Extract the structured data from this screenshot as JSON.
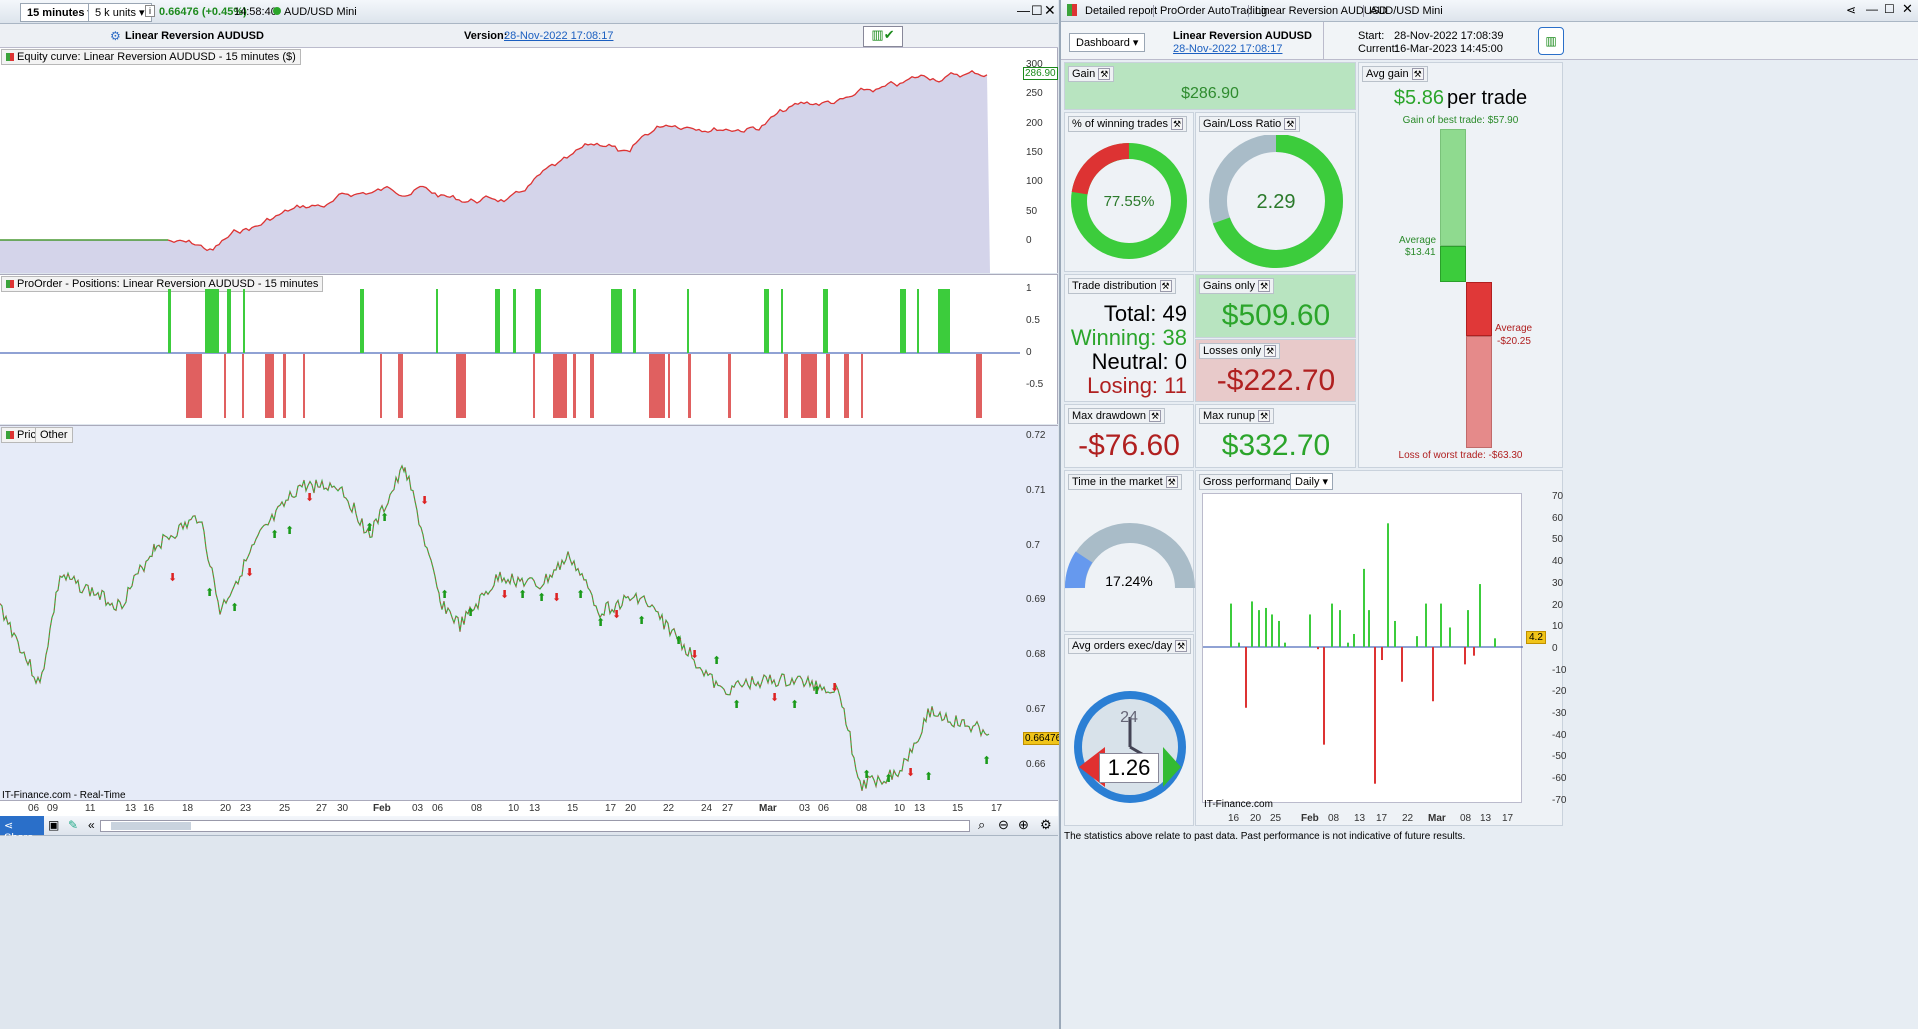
{
  "topbar": {
    "timeframe": "15 minutes",
    "units": "5 k units",
    "price": "0.66476 (+0.45%)",
    "time": "14:58:40",
    "instrument": "AUD/USD Mini"
  },
  "strategy": {
    "name": "Linear Reversion AUDUSD",
    "version_label": "Version:",
    "version": "28-Nov-2022 17:08:17"
  },
  "panels": {
    "equity": "Equity curve: Linear Reversion AUDUSD - 15 minutes ($)",
    "positions": "ProOrder - Positions: Linear Reversion AUDUSD - 15 minutes",
    "price": "Price",
    "other": "Other"
  },
  "equity_axis": [
    "300",
    "250",
    "200",
    "150",
    "100",
    "50",
    "0"
  ],
  "equity_last": "286.90",
  "pos_axis": [
    "1",
    "0.5",
    "0",
    "-0.5"
  ],
  "price_axis": [
    "0.72",
    "0.71",
    "0.7",
    "0.69",
    "0.68",
    "0.67",
    "0.66"
  ],
  "price_last": "0.66476",
  "x_axis": [
    "06",
    "09",
    "11",
    "13",
    "16",
    "18",
    "20",
    "23",
    "25",
    "27",
    "30",
    "Feb",
    "03",
    "06",
    "08",
    "10",
    "13",
    "15",
    "17",
    "20",
    "22",
    "24",
    "27",
    "Mar",
    "03",
    "06",
    "08",
    "10",
    "13",
    "15",
    "17"
  ],
  "footer_src": "IT-Finance.com - Real-Time",
  "bottom": {
    "share": "Share"
  },
  "tabs": [
    "Detailed report",
    "ProOrder AutoTrading",
    "Linear Reversion AUDUSD",
    "AUD/USD Mini"
  ],
  "report": {
    "dashboard": "Dashboard",
    "name": "Linear Reversion AUDUSD",
    "date": "28-Nov-2022 17:08:17",
    "start_label": "Start:",
    "start": "28-Nov-2022 17:08:39",
    "current_label": "Current:",
    "current": "16-Mar-2023 14:45:00"
  },
  "stats": {
    "gain_t": "Gain",
    "gain": "$286.90",
    "avg_t": "Avg gain",
    "avg": "$5.86",
    "avg_unit": "per trade",
    "best": "Gain of best trade: $57.90",
    "avg_lbl": "Average",
    "avg_pos": "$13.41",
    "avg_neg_lbl": "Average",
    "avg_neg": "-$20.25",
    "worst": "Loss of worst trade: -$63.30",
    "win_t": "% of winning trades",
    "win": "77.55%",
    "gl_t": "Gain/Loss Ratio",
    "gl": "2.29",
    "td_t": "Trade distribution",
    "total": "Total: 49",
    "winning": "Winning: 38",
    "neutral": "Neutral: 0",
    "losing": "Losing: 11",
    "go_t": "Gains only",
    "go": "$509.60",
    "lo_t": "Losses only",
    "lo": "-$222.70",
    "md_t": "Max drawdown",
    "md": "-$76.60",
    "mr_t": "Max runup",
    "mr": "$332.70",
    "tm_t": "Time in the market",
    "tm": "17.24%",
    "gp_t": "Gross performance",
    "gp_period": "Daily",
    "ao_t": "Avg orders exec/day",
    "ao": "1.26",
    "clock": "24"
  },
  "gp_axis": [
    "70",
    "60",
    "50",
    "40",
    "30",
    "20",
    "10",
    "0",
    "-10",
    "-20",
    "-30",
    "-40",
    "-50",
    "-60",
    "-70"
  ],
  "gp_last": "4.2",
  "gp_x": [
    "16",
    "20",
    "25",
    "Feb",
    "08",
    "13",
    "17",
    "22",
    "Mar",
    "08",
    "13",
    "17"
  ],
  "disclaimer": "The statistics above relate to past data. Past performance is not indicative of future results.",
  "colors": {
    "green": "#33cc33",
    "red": "#dd3333",
    "grey": "#a9bcc8"
  }
}
